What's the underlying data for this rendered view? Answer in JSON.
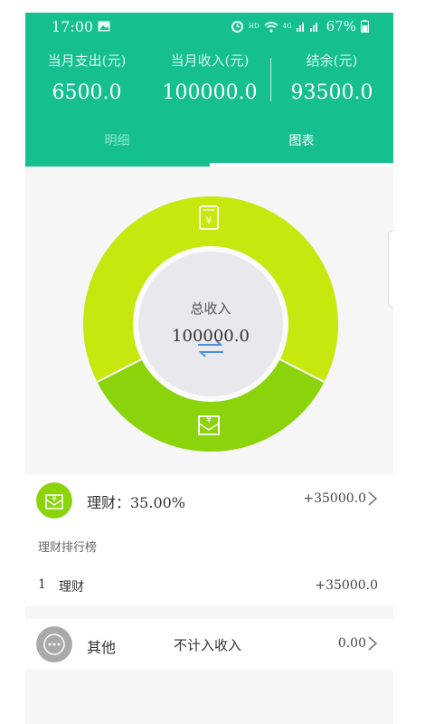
{
  "status_bar": {
    "time": "17:00",
    "hd": "HD",
    "net": "4G",
    "battery": "67%"
  },
  "summary": {
    "expense_label": "当月支出(元)",
    "expense_value": "6500.0",
    "income_label": "当月收入(元)",
    "income_value": "100000.0",
    "balance_label": "结余(元)",
    "balance_value": "93500.0"
  },
  "tabs": {
    "detail": "明细",
    "chart": "图表",
    "active": "chart"
  },
  "donut": {
    "center_label": "总收入",
    "center_value": "100000.0",
    "segments": [
      {
        "name": "理财",
        "percent": 35.0,
        "color": "#8bd30b"
      },
      {
        "name": "其他",
        "percent": 65.0,
        "color": "#c6e80f"
      }
    ]
  },
  "category_row": {
    "title": "理财：35.00%",
    "amount": "+35000.0"
  },
  "ranking": {
    "heading": "理财排行榜",
    "items": [
      {
        "rank": "1",
        "name": "理财",
        "amount": "+35000.0"
      }
    ]
  },
  "other_row": {
    "name": "其他",
    "note": "不计入收入",
    "amount": "0.00"
  },
  "colors": {
    "header": "#16bf8f",
    "finance_icon": "#8bd30b",
    "other_icon": "#a9a9a9"
  }
}
